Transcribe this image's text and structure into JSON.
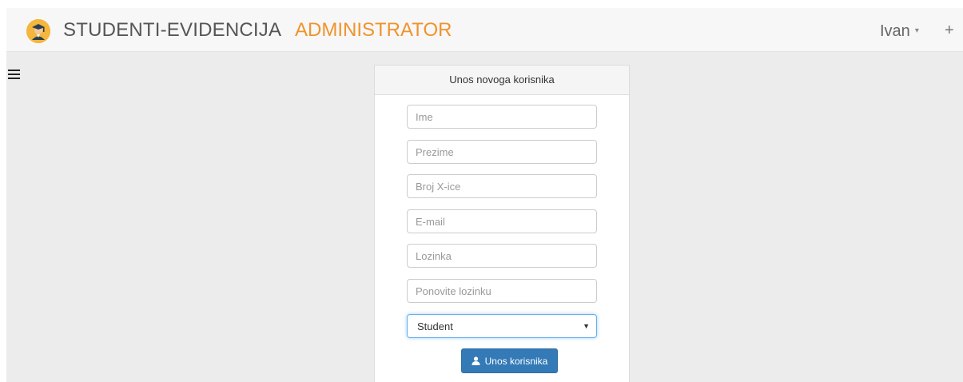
{
  "header": {
    "brand": "STUDENTI-EVIDENCIJA",
    "role": "ADMINISTRATOR",
    "user": "Ivan",
    "caret": "▾",
    "plus": "+",
    "brand_color": "#555555",
    "role_color": "#f0932b"
  },
  "form": {
    "title": "Unos novoga korisnika",
    "fields": [
      {
        "placeholder": "Ime",
        "value": ""
      },
      {
        "placeholder": "Prezime",
        "value": ""
      },
      {
        "placeholder": "Broj X-ice",
        "value": ""
      },
      {
        "placeholder": "E-mail",
        "value": ""
      },
      {
        "placeholder": "Lozinka",
        "value": ""
      },
      {
        "placeholder": "Ponovite lozinku",
        "value": ""
      }
    ],
    "role_select": {
      "selected": "Student"
    },
    "submit_label": "Unos korisnika",
    "submit_color": "#337ab7"
  },
  "icons": {
    "logo": "graduate-icon",
    "menu": "hamburger-icon",
    "submit": "user-icon"
  }
}
